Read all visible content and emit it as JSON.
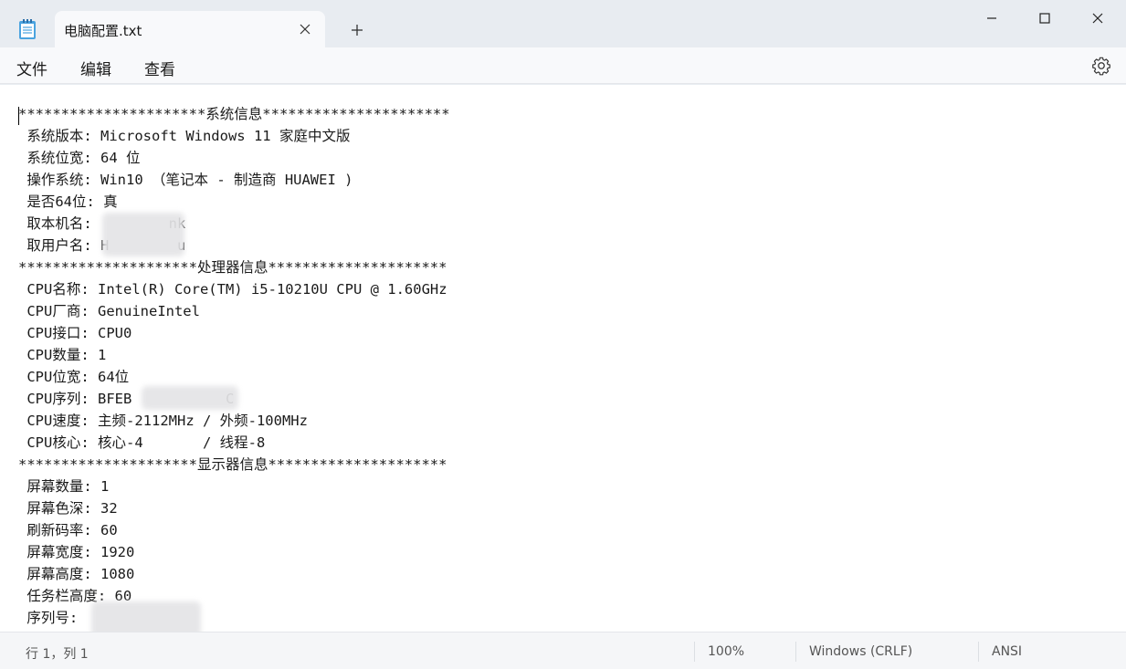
{
  "window": {
    "tab_title": "电脑配置.txt",
    "icons": {
      "app": "notepad-icon",
      "close_tab": "close-icon",
      "new_tab": "plus-icon",
      "minimize": "minimize-icon",
      "maximize": "maximize-icon",
      "close": "close-icon",
      "settings": "gear-icon"
    }
  },
  "menu": {
    "file": "文件",
    "edit": "编辑",
    "view": "查看"
  },
  "document": {
    "lines": [
      "**********************系统信息**********************",
      " 系统版本: Microsoft Windows 11 家庭中文版",
      " 系统位宽: 64 位",
      " 操作系统: Win10 （笔记本 - 制造商 HUAWEI )",
      " 是否64位: 真",
      " 取本机名:         nk",
      " 取用户名: H        u",
      "*********************处理器信息*********************",
      " CPU名称: Intel(R) Core(TM) i5-10210U CPU @ 1.60GHz",
      " CPU厂商: GenuineIntel",
      " CPU接口: CPU0",
      " CPU数量: 1",
      " CPU位宽: 64位",
      " CPU序列: BFEB           C",
      " CPU速度: 主频-2112MHz / 外频-100MHz",
      " CPU核心: 核心-4       / 线程-8",
      "*********************显示器信息*********************",
      " 屏幕数量: 1",
      " 屏幕色深: 32",
      " 刷新码率: 60",
      " 屏幕宽度: 1920",
      " 屏幕高度: 1080",
      " 任务栏高度: 60",
      " 序列号: "
    ]
  },
  "status": {
    "position": "行 1，列 1",
    "zoom": "100%",
    "line_ending": "Windows (CRLF)",
    "encoding": "ANSI"
  }
}
